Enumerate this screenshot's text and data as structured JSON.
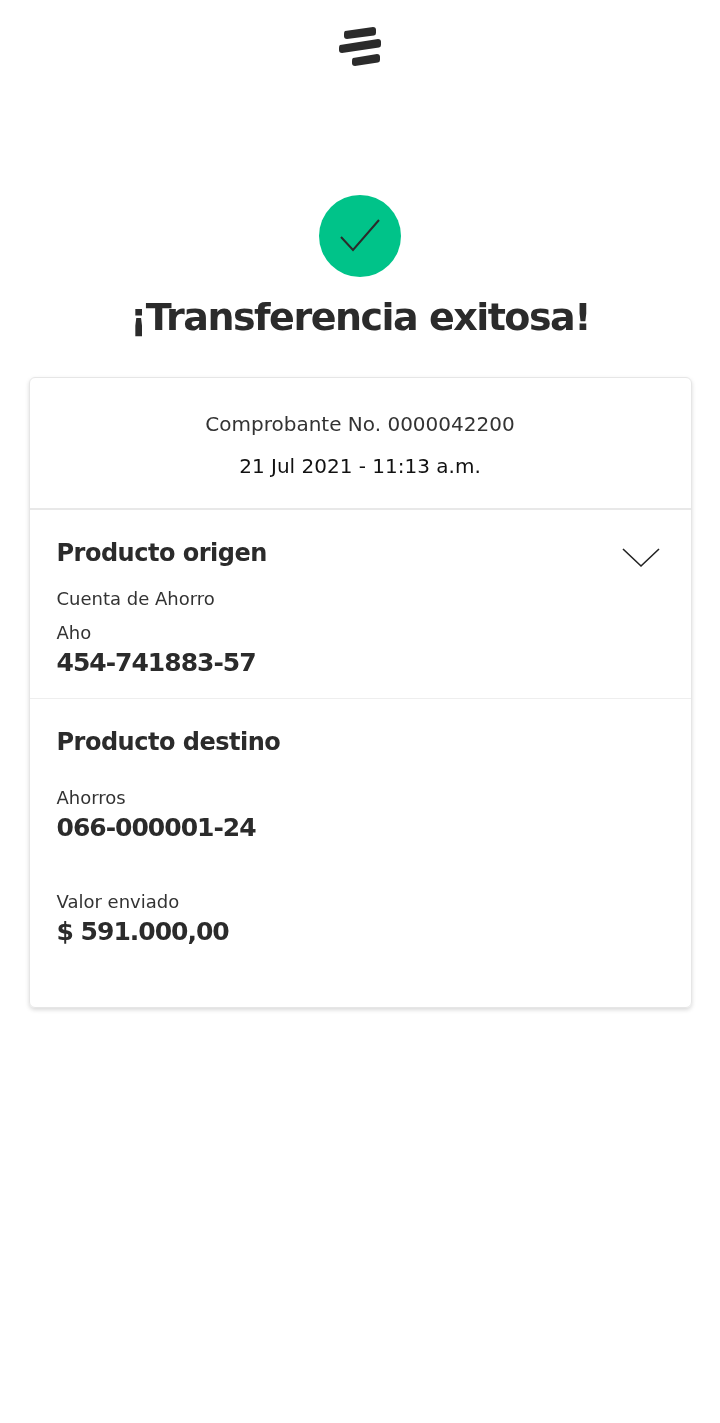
{
  "title": "¡Transferencia exitosa!",
  "receipt": {
    "number": "Comprobante No. 0000042200",
    "datetime": "21 Jul 2021 - 11:13 a.m."
  },
  "origin": {
    "heading": "Producto origen",
    "lines": [
      "Cuenta de Ahorro",
      "Aho"
    ],
    "account": "454-741883-57"
  },
  "destination": {
    "heading": "Producto destino",
    "type": "Ahorros",
    "account": "066-000001-24",
    "amount_label": "Valor enviado",
    "amount": "$ 591.000,00"
  }
}
